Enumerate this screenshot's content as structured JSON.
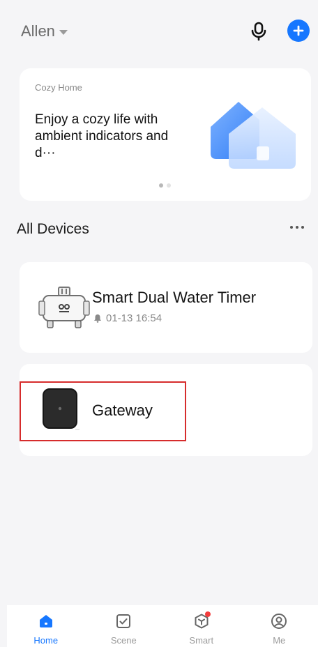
{
  "header": {
    "home_name": "Allen"
  },
  "banner": {
    "eyebrow": "Cozy Home",
    "title": "Enjoy a cozy life with ambient indicators and d···",
    "page_count": 2,
    "active_page": 1
  },
  "devices_section": {
    "title": "All Devices"
  },
  "devices": [
    {
      "name": "Smart Dual Water Timer",
      "status": "01-13 16:54"
    },
    {
      "name": "Gateway"
    }
  ],
  "tabs": [
    {
      "label": "Home",
      "active": true
    },
    {
      "label": "Scene",
      "active": false
    },
    {
      "label": "Smart",
      "active": false
    },
    {
      "label": "Me",
      "active": false
    }
  ],
  "colors": {
    "accent": "#1677ff",
    "highlight": "#d62c2c",
    "badge": "#f23c3c",
    "background": "#f5f5f7"
  },
  "icons": {
    "mic": "microphone-icon",
    "add": "plus-circle-icon",
    "more": "ellipsis-icon",
    "status": "bell-icon"
  }
}
